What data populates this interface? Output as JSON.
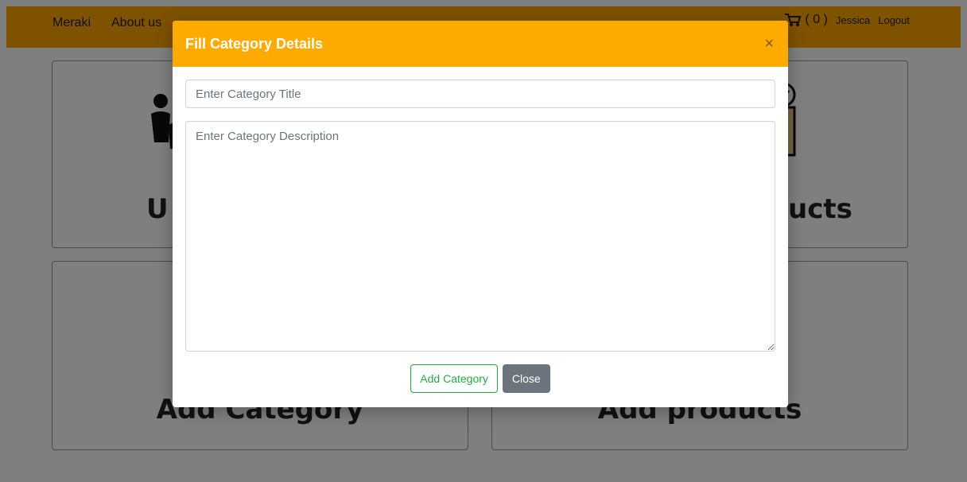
{
  "navbar": {
    "brand": "Meraki",
    "about": "About us",
    "cart_count": "( 0 )",
    "user": "Jessica",
    "logout": "Logout"
  },
  "cards": {
    "c1_title": "U",
    "c2_title": "ucts",
    "c3_title": "Add Category",
    "c4_title": "Add products"
  },
  "modal": {
    "title": "Fill Category Details",
    "close_symbol": "×",
    "title_placeholder": "Enter Category Title",
    "description_placeholder": "Enter Category Description",
    "add_button": "Add Category",
    "close_button": "Close"
  },
  "colors": {
    "header": "#ffaa00",
    "navbar": "#ffa500",
    "success": "#28a745",
    "secondary": "#6c757d"
  }
}
